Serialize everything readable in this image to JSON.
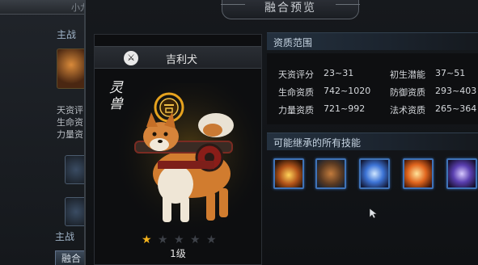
{
  "background_panel": {
    "top_text": "小九",
    "section_title": "主战",
    "stats": [
      "天资评",
      "生命资",
      "力量资"
    ],
    "bottom_tab": "主战",
    "fuse_button": "融合"
  },
  "dialog": {
    "title": "融合预览"
  },
  "pet": {
    "type_icon": "sword-icon",
    "name": "吉利犬",
    "rank_label": "灵兽",
    "stars_filled": 1,
    "stars_total": 5,
    "level": "1级"
  },
  "aptitude": {
    "title": "资质范围",
    "rows": [
      [
        {
          "label": "天资评分",
          "value": "23~31"
        },
        {
          "label": "初生潜能",
          "value": "37~51"
        }
      ],
      [
        {
          "label": "生命资质",
          "value": "742~1020"
        },
        {
          "label": "防御资质",
          "value": "293~403"
        }
      ],
      [
        {
          "label": "力量资质",
          "value": "721~992"
        },
        {
          "label": "法术资质",
          "value": "265~364"
        }
      ]
    ]
  },
  "skills": {
    "title": "可能继承的所有技能",
    "icons": [
      "flame-burst-skill-icon",
      "beast-claw-skill-icon",
      "blue-orb-skill-icon",
      "fire-slash-skill-icon",
      "lightning-skill-icon"
    ]
  },
  "colors": {
    "star_on": "#f3b21c",
    "skill_border": "#3f73b7",
    "section_header": "#24313f"
  }
}
